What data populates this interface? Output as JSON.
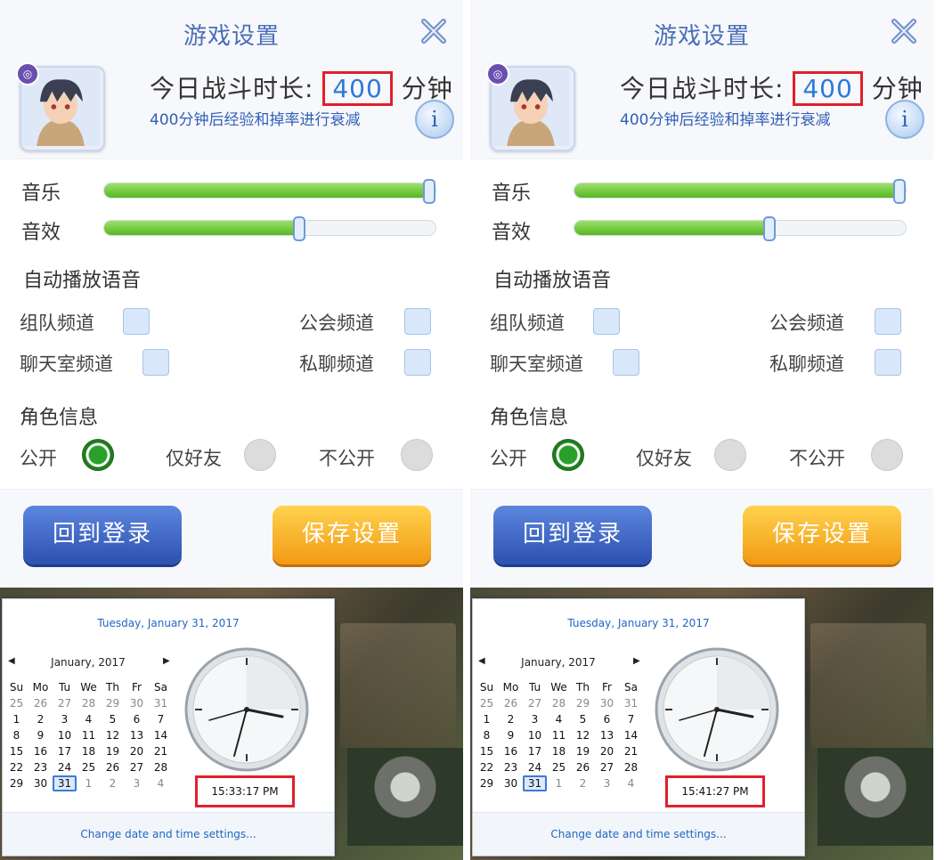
{
  "panels": [
    {
      "title": "游戏设置",
      "duration": {
        "prefix": "今日战斗时长:",
        "value": "400",
        "unit": "分钟"
      },
      "decay_note": "400分钟后经验和掉率进行衰减",
      "info_label": "i",
      "avatar_badge": "◎",
      "music_label": "音乐",
      "sfx_label": "音效",
      "music_level": 0.98,
      "sfx_level": 0.59,
      "auto_voice_title": "自动播放语音",
      "channels": [
        {
          "label": "组队频道",
          "checked": false
        },
        {
          "label": "公会频道",
          "checked": false
        },
        {
          "label": "聊天室频道",
          "checked": false
        },
        {
          "label": "私聊频道",
          "checked": false
        }
      ],
      "role_info_title": "角色信息",
      "role_options": [
        {
          "label": "公开",
          "selected": true
        },
        {
          "label": "仅好友",
          "selected": false
        },
        {
          "label": "不公开",
          "selected": false
        }
      ],
      "back_button": "回到登录",
      "save_button": "保存设置",
      "calendar": {
        "date_line": "Tuesday, January 31, 2017",
        "month": "January, 2017",
        "prev": "◀",
        "next": "▶",
        "weekdays": [
          "Su",
          "Mo",
          "Tu",
          "We",
          "Th",
          "Fr",
          "Sa"
        ],
        "weeks": [
          [
            "25",
            "26",
            "27",
            "28",
            "29",
            "30",
            "31"
          ],
          [
            "1",
            "2",
            "3",
            "4",
            "5",
            "6",
            "7"
          ],
          [
            "8",
            "9",
            "10",
            "11",
            "12",
            "13",
            "14"
          ],
          [
            "15",
            "16",
            "17",
            "18",
            "19",
            "20",
            "21"
          ],
          [
            "22",
            "23",
            "24",
            "25",
            "26",
            "27",
            "28"
          ],
          [
            "29",
            "30",
            "31",
            "1",
            "2",
            "3",
            "4"
          ]
        ],
        "time": "15:33:17 PM",
        "footer_link": "Change date and time settings..."
      }
    },
    {
      "title": "游戏设置",
      "duration": {
        "prefix": "今日战斗时长:",
        "value": "400",
        "unit": "分钟"
      },
      "decay_note": "400分钟后经验和掉率进行衰减",
      "info_label": "i",
      "avatar_badge": "◎",
      "music_label": "音乐",
      "sfx_label": "音效",
      "music_level": 0.98,
      "sfx_level": 0.59,
      "auto_voice_title": "自动播放语音",
      "channels": [
        {
          "label": "组队频道",
          "checked": false
        },
        {
          "label": "公会频道",
          "checked": false
        },
        {
          "label": "聊天室频道",
          "checked": false
        },
        {
          "label": "私聊频道",
          "checked": false
        }
      ],
      "role_info_title": "角色信息",
      "role_options": [
        {
          "label": "公开",
          "selected": true
        },
        {
          "label": "仅好友",
          "selected": false
        },
        {
          "label": "不公开",
          "selected": false
        }
      ],
      "back_button": "回到登录",
      "save_button": "保存设置",
      "calendar": {
        "date_line": "Tuesday, January 31, 2017",
        "month": "January, 2017",
        "prev": "◀",
        "next": "▶",
        "weekdays": [
          "Su",
          "Mo",
          "Tu",
          "We",
          "Th",
          "Fr",
          "Sa"
        ],
        "weeks": [
          [
            "25",
            "26",
            "27",
            "28",
            "29",
            "30",
            "31"
          ],
          [
            "1",
            "2",
            "3",
            "4",
            "5",
            "6",
            "7"
          ],
          [
            "8",
            "9",
            "10",
            "11",
            "12",
            "13",
            "14"
          ],
          [
            "15",
            "16",
            "17",
            "18",
            "19",
            "20",
            "21"
          ],
          [
            "22",
            "23",
            "24",
            "25",
            "26",
            "27",
            "28"
          ],
          [
            "29",
            "30",
            "31",
            "1",
            "2",
            "3",
            "4"
          ]
        ],
        "time": "15:41:27 PM",
        "footer_link": "Change date and time settings..."
      }
    }
  ],
  "colors": {
    "accent_blue": "#2b79d8",
    "highlight_red": "#e0212b",
    "slider_green": "#56b823",
    "save_orange": "#f29a14",
    "back_blue": "#2c51b0"
  },
  "icons": [
    "close-icon",
    "info-icon",
    "avatar-badge-icon",
    "clock-icon",
    "chevron-left-icon",
    "chevron-right-icon"
  ]
}
